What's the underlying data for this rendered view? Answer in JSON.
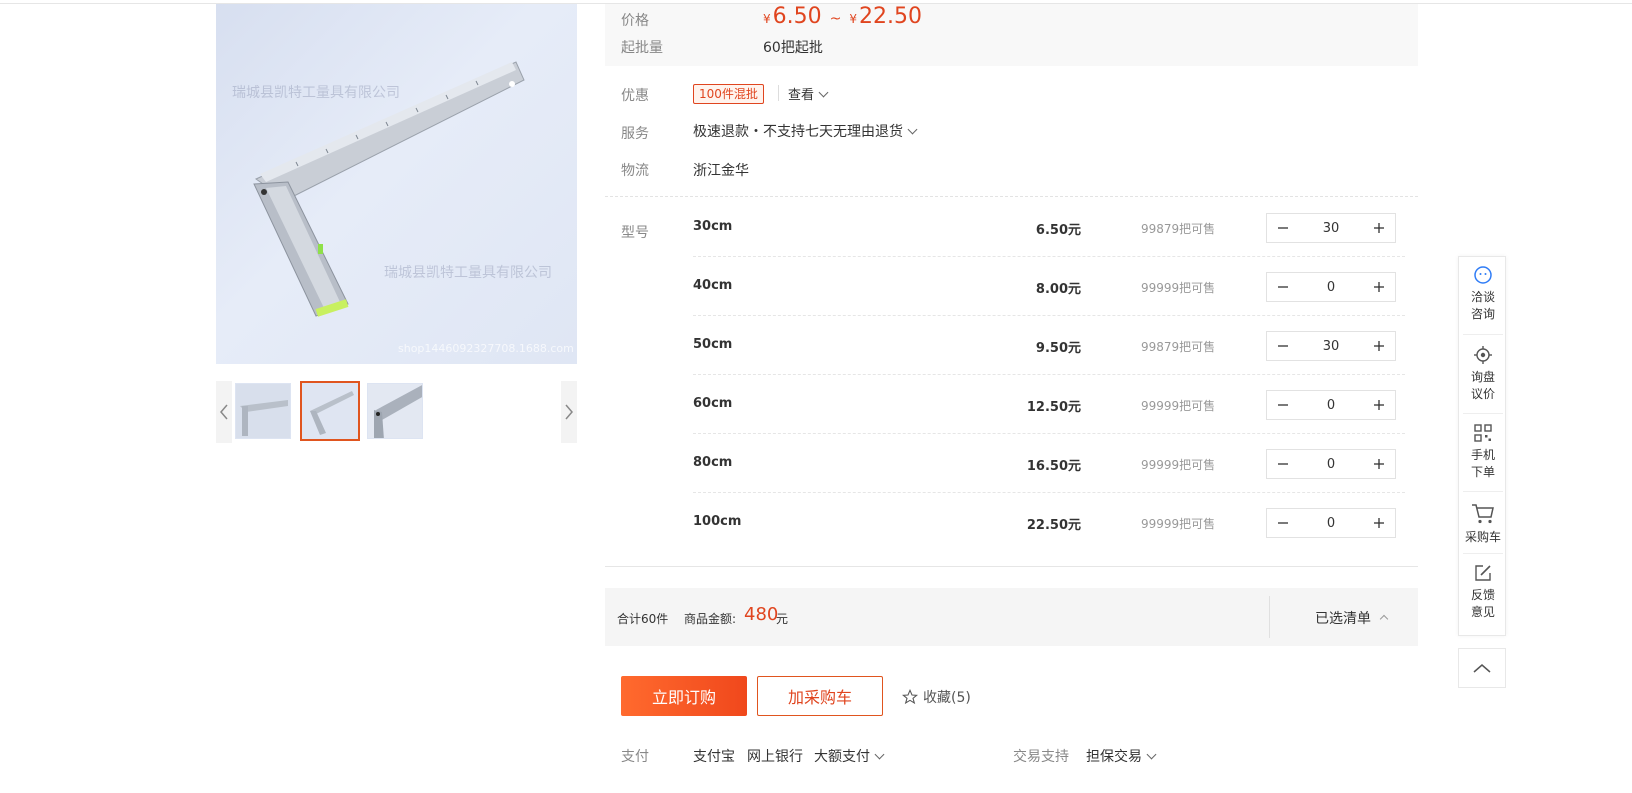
{
  "gallery": {
    "watermarks": [
      "瑞城县凯特工量具有限公司",
      "瑞城县凯特工量具有限公司",
      "shop1446092327708.1688.com"
    ],
    "thumb_count": 3,
    "active_thumb": 2
  },
  "price": {
    "label": "价格",
    "currency": "¥",
    "min": "6.50",
    "sep": "~",
    "max": "22.50"
  },
  "moq": {
    "label": "起批量",
    "value": "60把起批"
  },
  "promo": {
    "label": "优惠",
    "tag": "100件混批",
    "link": "查看"
  },
  "service": {
    "label": "服务",
    "value": "极速退款・不支持七天无理由退货"
  },
  "logistics": {
    "label": "物流",
    "value": "浙江金华"
  },
  "sku": {
    "label": "型号",
    "unit_suffix": "元",
    "rows": [
      {
        "name": "30cm",
        "price": "6.50元",
        "stock": "99879把可售",
        "qty": "30"
      },
      {
        "name": "40cm",
        "price": "8.00元",
        "stock": "99999把可售",
        "qty": "0"
      },
      {
        "name": "50cm",
        "price": "9.50元",
        "stock": "99879把可售",
        "qty": "30"
      },
      {
        "name": "60cm",
        "price": "12.50元",
        "stock": "99999把可售",
        "qty": "0"
      },
      {
        "name": "80cm",
        "price": "16.50元",
        "stock": "99999把可售",
        "qty": "0"
      },
      {
        "name": "100cm",
        "price": "22.50元",
        "stock": "99999把可售",
        "qty": "0"
      }
    ]
  },
  "summary": {
    "total_count": "合计60件",
    "amount_label": "商品金额:",
    "amount": "480",
    "amount_unit": "元",
    "list_button": "已选清单"
  },
  "actions": {
    "buy_now": "立即订购",
    "add_cart": "加采购车",
    "favorite": "收藏(5)"
  },
  "payment": {
    "label": "支付",
    "methods": [
      "支付宝",
      "网上银行",
      "大额支付"
    ],
    "support_label": "交易支持",
    "support_value": "担保交易"
  },
  "sidebar": {
    "items": [
      "洽谈咨询",
      "询盘议价",
      "手机下单",
      "采购车",
      "反馈意见"
    ],
    "items_lines": [
      [
        "洽谈",
        "咨询"
      ],
      [
        "询盘",
        "议价"
      ],
      [
        "手机",
        "下单"
      ],
      [
        "采购车"
      ],
      [
        "反馈",
        "意见"
      ]
    ]
  },
  "colors": {
    "accent": "#e0451f",
    "button_gradient_start": "#ff6a2e",
    "button_gradient_end": "#f0481c"
  }
}
